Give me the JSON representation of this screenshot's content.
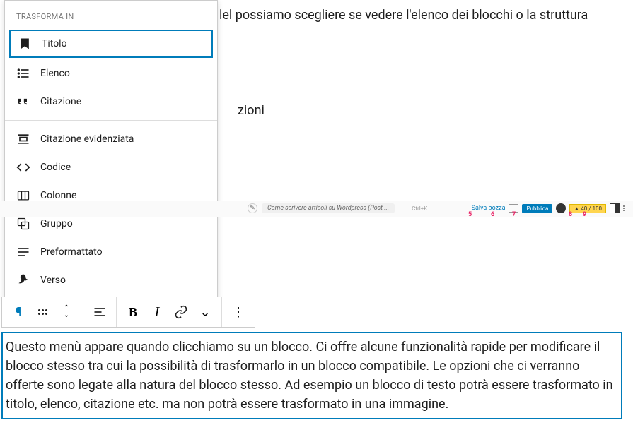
{
  "bg_text": {
    "line1": "lel possiamo scegliere se vedere l'elenco dei blocchi o la struttura",
    "line2": "zioni"
  },
  "dropdown": {
    "header": "TRASFORMA IN",
    "items_top": [
      {
        "label": "Titolo",
        "icon": "bookmark"
      },
      {
        "label": "Elenco",
        "icon": "list"
      },
      {
        "label": "Citazione",
        "icon": "quote"
      }
    ],
    "items_bottom": [
      {
        "label": "Citazione evidenziata",
        "icon": "pullquote"
      },
      {
        "label": "Codice",
        "icon": "code"
      },
      {
        "label": "Colonne",
        "icon": "columns"
      },
      {
        "label": "Gruppo",
        "icon": "group"
      },
      {
        "label": "Preformattato",
        "icon": "pre"
      },
      {
        "label": "Verso",
        "icon": "verse"
      }
    ]
  },
  "topbar": {
    "title": "Come scrivere articoli su Wordpress (Post ...",
    "shortcut": "Ctrl+K",
    "save": "Salva bozza",
    "publish": "Pubblica",
    "yoast": "▲ 40 / 100"
  },
  "annotations": {
    "a5": "5",
    "a6": "6",
    "a7": "7",
    "a8": "8",
    "a9": "9"
  },
  "block_text": "Questo menù appare quando clicchiamo su un blocco. Ci offre alcune funzionalità rapide per modificare il blocco stesso tra cui la possibilità di trasformarlo in un blocco compatibile. Le opzioni che ci verranno offerte sono legate alla natura del blocco stesso. Ad esempio un blocco di testo potrà essere trasformato in titolo, elenco, citazione etc. ma non potrà essere trasformato in una immagine.",
  "toolbar_glyphs": {
    "bold": "B",
    "italic": "I",
    "more": "⋮"
  }
}
